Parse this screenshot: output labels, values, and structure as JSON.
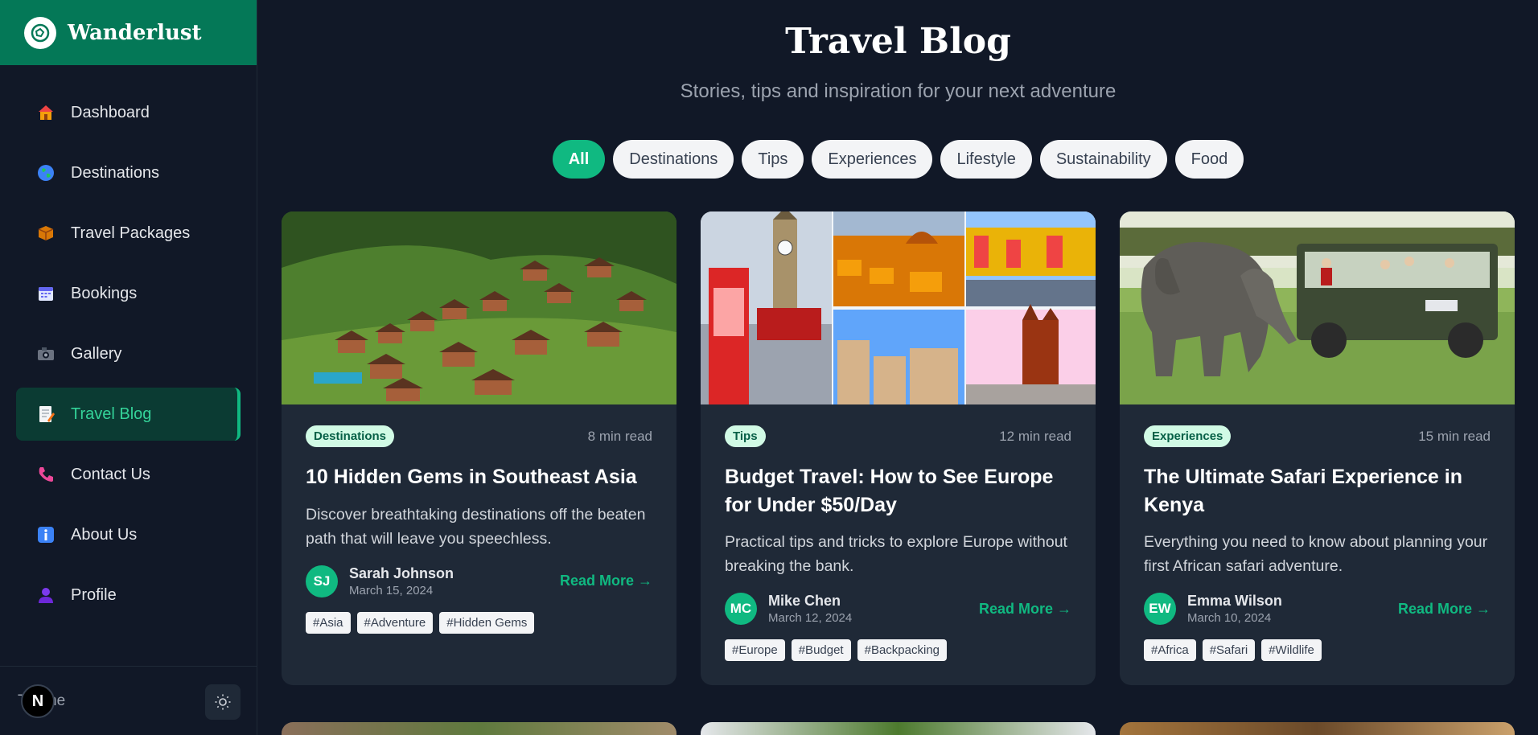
{
  "brand": {
    "name": "Wanderlust"
  },
  "nav": {
    "items": [
      {
        "label": "Dashboard",
        "icon": "house-icon"
      },
      {
        "label": "Destinations",
        "icon": "globe-icon"
      },
      {
        "label": "Travel Packages",
        "icon": "package-icon"
      },
      {
        "label": "Bookings",
        "icon": "calendar-icon"
      },
      {
        "label": "Gallery",
        "icon": "camera-icon"
      },
      {
        "label": "Travel Blog",
        "icon": "memo-icon",
        "active": true
      },
      {
        "label": "Contact Us",
        "icon": "phone-icon"
      },
      {
        "label": "About Us",
        "icon": "info-icon"
      },
      {
        "label": "Profile",
        "icon": "user-icon"
      }
    ]
  },
  "footer": {
    "label": "Theme",
    "badge": "N"
  },
  "page": {
    "title": "Travel Blog",
    "subtitle": "Stories, tips and inspiration for your next adventure"
  },
  "filters": [
    "All",
    "Destinations",
    "Tips",
    "Experiences",
    "Lifestyle",
    "Sustainability",
    "Food"
  ],
  "active_filter": "All",
  "posts": [
    {
      "category": "Destinations",
      "read_time": "8 min read",
      "title": "10 Hidden Gems in Southeast Asia",
      "excerpt": "Discover breathtaking destinations off the beaten path that will leave you speechless.",
      "author_initials": "SJ",
      "author": "Sarah Johnson",
      "date": "March 15, 2024",
      "read_more": "Read More →",
      "tags": [
        "#Asia",
        "#Adventure",
        "#Hidden Gems"
      ]
    },
    {
      "category": "Tips",
      "read_time": "12 min read",
      "title": "Budget Travel: How to See Europe for Under $50/Day",
      "excerpt": "Practical tips and tricks to explore Europe without breaking the bank.",
      "author_initials": "MC",
      "author": "Mike Chen",
      "date": "March 12, 2024",
      "read_more": "Read More →",
      "tags": [
        "#Europe",
        "#Budget",
        "#Backpacking"
      ]
    },
    {
      "category": "Experiences",
      "read_time": "15 min read",
      "title": "The Ultimate Safari Experience in Kenya",
      "excerpt": "Everything you need to know about planning your first African safari adventure.",
      "author_initials": "EW",
      "author": "Emma Wilson",
      "date": "March 10, 2024",
      "read_more": "Read More →",
      "tags": [
        "#Africa",
        "#Safari",
        "#Wildlife"
      ]
    }
  ],
  "colors": {
    "brand": "#047857",
    "accent": "#10b981",
    "background": "#111827",
    "card": "#1f2937"
  }
}
